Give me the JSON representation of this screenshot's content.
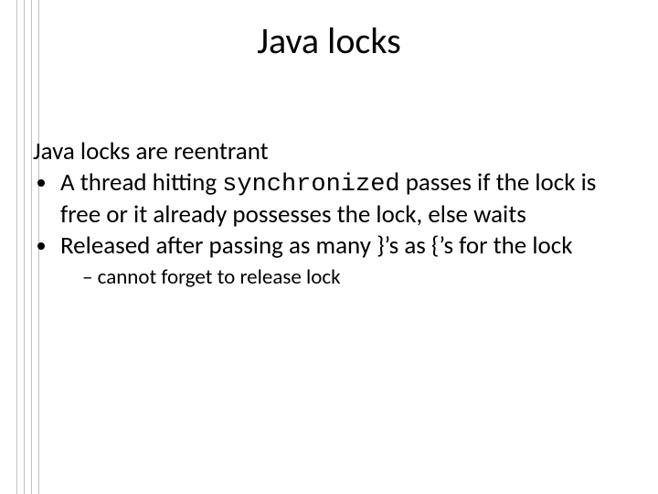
{
  "title": "Java locks",
  "lead": "Java locks are reentrant",
  "bullets": [
    {
      "pre": "A thread hitting ",
      "code": "synchronized",
      "post": " passes if the lock is free or it already possesses the lock, else waits"
    },
    {
      "text": "Released after passing as many }’s as {’s for the lock",
      "sub": [
        "cannot forget to release lock"
      ]
    }
  ]
}
